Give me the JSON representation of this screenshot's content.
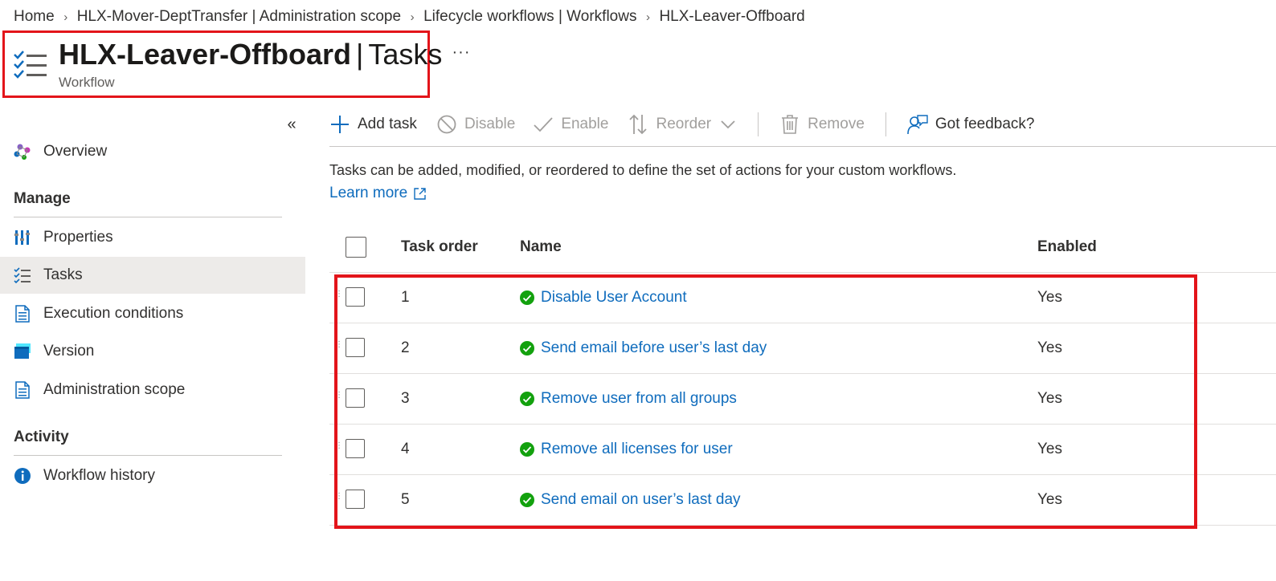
{
  "breadcrumb": [
    "Home",
    "HLX-Mover-DeptTransfer | Administration scope",
    "Lifecycle workflows | Workflows",
    "HLX-Leaver-Offboard"
  ],
  "header": {
    "title_main": "HLX-Leaver-Offboard",
    "title_divider": "|",
    "title_section": "Tasks",
    "subtitle": "Workflow",
    "more": "···"
  },
  "sidebar": {
    "collapse": "«",
    "overview": "Overview",
    "manage_heading": "Manage",
    "manage_items": [
      "Properties",
      "Tasks",
      "Execution conditions",
      "Version",
      "Administration scope"
    ],
    "activity_heading": "Activity",
    "activity_items": [
      "Workflow history"
    ],
    "active_item": "Tasks"
  },
  "toolbar": {
    "add_task": "Add task",
    "disable": "Disable",
    "enable": "Enable",
    "reorder": "Reorder",
    "remove": "Remove",
    "feedback": "Got feedback?"
  },
  "description": "Tasks can be added, modified, or reordered to define the set of actions for your custom workflows.",
  "learn_more": "Learn more",
  "table": {
    "columns": [
      "Task order",
      "Name",
      "Enabled"
    ],
    "rows": [
      {
        "order": "1",
        "name": "Disable User Account",
        "enabled": "Yes"
      },
      {
        "order": "2",
        "name": "Send email before user’s last day",
        "enabled": "Yes"
      },
      {
        "order": "3",
        "name": "Remove user from all groups",
        "enabled": "Yes"
      },
      {
        "order": "4",
        "name": "Remove all licenses for user",
        "enabled": "Yes"
      },
      {
        "order": "5",
        "name": "Send email on user’s last day",
        "enabled": "Yes"
      }
    ]
  },
  "colors": {
    "accent": "#0f6cbd",
    "success": "#13a10e",
    "highlight": "#e3141a",
    "disabled": "#a19f9d"
  },
  "icons": {
    "page": "task-list-icon",
    "overview": "overview-icon",
    "properties": "properties-icon",
    "tasks": "task-list-icon",
    "execution_conditions": "document-icon",
    "version": "version-icon",
    "administration_scope": "document-icon",
    "workflow_history": "info-icon",
    "status": "check-circle-icon"
  }
}
